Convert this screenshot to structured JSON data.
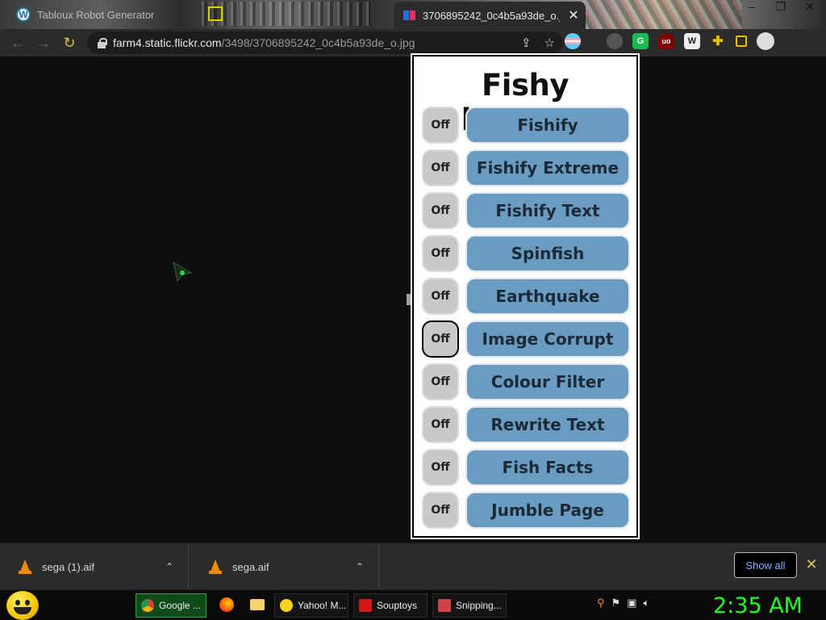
{
  "browser": {
    "tabs": [
      {
        "label": "Tabloux Robot Generator",
        "favicon": "wordpress-icon",
        "active": false
      },
      {
        "label": "3706895242_0c4b5a93de_o.jpg",
        "favicon": "flickr-icon",
        "active": true
      }
    ],
    "tab_close": "✕",
    "window_controls": {
      "minimize": "–",
      "restore": "❐",
      "close": "✕"
    },
    "nav": {
      "back": "←",
      "forward": "→",
      "reload": "↻"
    },
    "url": {
      "host": "farm4.static.flickr.com",
      "path": "/3498/3706895242_0c4b5a93de_o.jpg"
    },
    "omnibox_icons": {
      "share": "⇪",
      "bookmark": "☆"
    },
    "extensions": [
      {
        "name": "trans-flag-extension-icon",
        "label": ""
      },
      {
        "name": "spy-extension-icon",
        "label": ""
      },
      {
        "name": "green-extension-icon",
        "label": "G"
      },
      {
        "name": "ublock-extension-icon",
        "label": "uo"
      },
      {
        "name": "wappalyzer-extension-icon",
        "label": "W"
      },
      {
        "name": "puzzle-extensions-icon",
        "label": ""
      },
      {
        "name": "sidepanel-icon",
        "label": ""
      },
      {
        "name": "profile-avatar-icon",
        "label": ""
      }
    ]
  },
  "fishy_panel": {
    "title": "Fishy buttons",
    "rows": [
      {
        "toggle": "Off",
        "action": "Fishify"
      },
      {
        "toggle": "Off",
        "action": "Fishify Extreme"
      },
      {
        "toggle": "Off",
        "action": "Fishify Text"
      },
      {
        "toggle": "Off",
        "action": "Spinfish"
      },
      {
        "toggle": "Off",
        "action": "Earthquake"
      },
      {
        "toggle": "Off",
        "action": "Image Corrupt",
        "focused": true
      },
      {
        "toggle": "Off",
        "action": "Colour Filter"
      },
      {
        "toggle": "Off",
        "action": "Rewrite Text"
      },
      {
        "toggle": "Off",
        "action": "Fish Facts"
      },
      {
        "toggle": "Off",
        "action": "Jumble Page"
      }
    ]
  },
  "downloads": {
    "items": [
      {
        "name": "sega (1).aif",
        "chevron": "⌃"
      },
      {
        "name": "sega.aif",
        "chevron": "⌃"
      }
    ],
    "show_all": "Show all",
    "close": "✕"
  },
  "taskbar": {
    "tasks": [
      {
        "label": "Google ...",
        "icon": "chrome-icon",
        "active": true
      },
      {
        "label": "Yahoo! M...",
        "icon": "yahoo-messenger-icon",
        "active": false
      },
      {
        "label": "Souptoys",
        "icon": "souptoys-icon",
        "active": false
      },
      {
        "label": "Snipping...",
        "icon": "snipping-tool-icon",
        "active": false
      }
    ],
    "quick_launch": [
      "firefox-icon",
      "folder-icon"
    ],
    "tray_icons": [
      "search-icon",
      "flag-icon",
      "network-icon",
      "volume-icon"
    ],
    "clock": "2:35 AM"
  },
  "colors": {
    "accent_button": "#6a9bc0",
    "toggle_button": "#c8c8c8",
    "clock": "#21ff21",
    "show_all_text": "#7fb0ff"
  }
}
